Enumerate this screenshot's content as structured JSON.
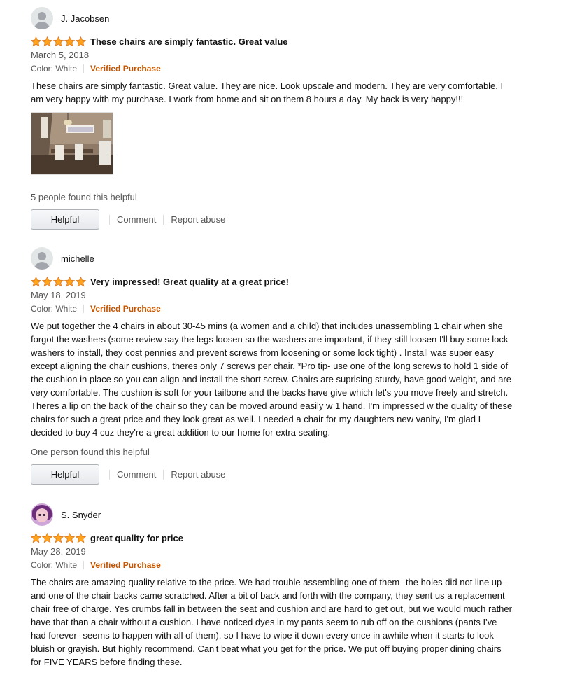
{
  "reviews": [
    {
      "reviewer": "J. Jacobsen",
      "rating": 5,
      "title": "These chairs are simply fantastic. Great value",
      "date": "March 5, 2018",
      "color": "Color: White",
      "verified": "Verified Purchase",
      "body": "These chairs are simply fantastic. Great value. They are nice. Look upscale and modern. They are very comfortable. I am very happy with my purchase. I work from home and sit on them 8 hours a day. My back is very happy!!!",
      "helpful_count": "5 people found this helpful",
      "helpful_label": "Helpful",
      "comment_label": "Comment",
      "report_label": "Report abuse"
    },
    {
      "reviewer": "michelle",
      "rating": 5,
      "title": "Very impressed! Great quality at a great price!",
      "date": "May 18, 2019",
      "color": "Color: White",
      "verified": "Verified Purchase",
      "body": "We put together the 4 chairs in about 30-45 mins (a women and a child) that includes unassembling 1 chair when she forgot the washers (some review say the legs loosen so the washers are important, if they still loosen I'll buy some lock washers to install, they cost pennies and prevent screws from loosening or some lock tight) . Install was super easy except aligning the chair cushions, theres only 7 screws per chair. *Pro tip- use one of the long screws to hold 1 side of the cushion in place so you can align and install the short screw. Chairs are suprising sturdy, have good weight, and are very comfortable. The cushion is soft for your tailbone and the backs have give which let's you move freely and stretch. Theres a lip on the back of the chair so they can be moved around easily w 1 hand. I'm impressed w the quality of these chairs for such a great price and they look great as well. I needed a chair for my daughters new vanity, I'm glad I decided to buy 4 cuz they're a great addition to our home for extra seating.",
      "helpful_count": "One person found this helpful",
      "helpful_label": "Helpful",
      "comment_label": "Comment",
      "report_label": "Report abuse"
    },
    {
      "reviewer": "S. Snyder",
      "rating": 5,
      "title": "great quality for price",
      "date": "May 28, 2019",
      "color": "Color: White",
      "verified": "Verified Purchase",
      "body": "The chairs are amazing quality relative to the price. We had trouble assembling one of them--the holes did not line up--and one of the chair backs came scratched. After a bit of back and forth with the company, they sent us a replacement chair free of charge. Yes crumbs fall in between the seat and cushion and are hard to get out, but we would much rather have that than a chair without a cushion. I have noticed dyes in my pants seem to rub off on the cushions (pants I've had forever--seems to happen with all of them), so I have to wipe it down every once in awhile when it starts to look bluish or grayish. But highly recommend. Can't beat what you get for the price. We put off buying proper dining chairs for FIVE YEARS before finding these."
    }
  ],
  "colors": {
    "star": "#ffa41c",
    "verified": "#c45500",
    "link_gray": "#555555"
  },
  "icons": {
    "star": "star-icon",
    "avatar": "default-avatar-icon"
  }
}
